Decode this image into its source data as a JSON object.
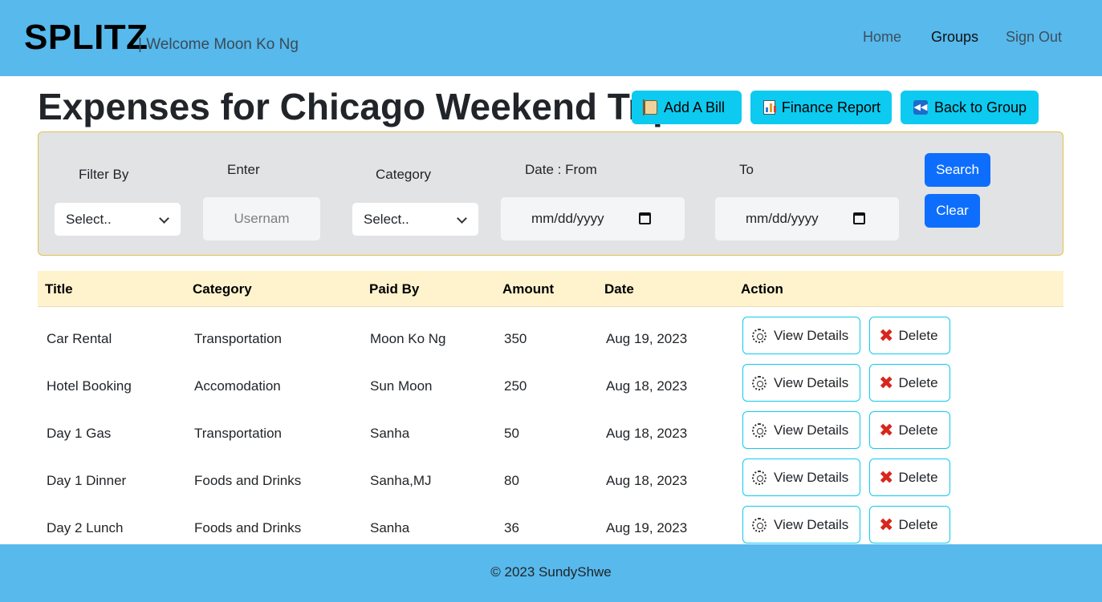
{
  "navbar": {
    "brand": "SPLITZ",
    "welcome": "| Welcome Moon Ko Ng",
    "links": {
      "home": "Home",
      "groups": "Groups",
      "signout": "Sign Out"
    }
  },
  "header": {
    "title": "Expenses for Chicago Weekend Trip",
    "add_bill": "Add A Bill",
    "finance_report": "Finance Report",
    "back_to_group": "Back to Group"
  },
  "filter": {
    "filter_by_label": "Filter By",
    "filter_by_value": "Select..",
    "enter_label": "Enter",
    "enter_placeholder": "Usernam",
    "category_label": "Category",
    "category_value": "Select..",
    "date_from_label": "Date : From",
    "date_from_value": "mm/dd/yyyy",
    "to_label": "To",
    "date_to_value": "mm/dd/yyyy",
    "search_button": "Search",
    "clear_button": "Clear"
  },
  "table": {
    "headers": [
      "Title",
      "Category",
      "Paid By",
      "Amount",
      "Date",
      "Action"
    ],
    "view_label": "View Details",
    "delete_label": "Delete",
    "rows": [
      {
        "title": "Car Rental",
        "category": "Transportation",
        "paid_by": "Moon Ko Ng",
        "amount": "350",
        "date": "Aug 19, 2023"
      },
      {
        "title": "Hotel Booking",
        "category": "Accomodation",
        "paid_by": "Sun Moon",
        "amount": "250",
        "date": "Aug 18, 2023"
      },
      {
        "title": "Day 1 Gas",
        "category": "Transportation",
        "paid_by": "Sanha",
        "amount": "50",
        "date": "Aug 18, 2023"
      },
      {
        "title": "Day 1 Dinner",
        "category": "Foods and Drinks",
        "paid_by": "Sanha,MJ",
        "amount": "80",
        "date": "Aug 18, 2023"
      },
      {
        "title": "Day 2 Lunch",
        "category": "Foods and Drinks",
        "paid_by": "Sanha",
        "amount": "36",
        "date": "Aug 19, 2023"
      }
    ]
  },
  "footer": {
    "text": "© 2023 SundyShwe"
  },
  "colors": {
    "navbar": "#57b9ec",
    "info_button": "#0dcaf0",
    "primary_button": "#0d6efd",
    "table_header": "#fff3cd",
    "filter_panel": "#e2e3e5"
  },
  "icons": {
    "add_bill": "scroll-icon",
    "finance_report": "bar-chart-icon",
    "back_to_group": "rewind-icon",
    "view_details": "gear-icon",
    "delete": "x-mark-icon",
    "date_picker": "calendar-icon",
    "select": "chevron-down-icon"
  }
}
